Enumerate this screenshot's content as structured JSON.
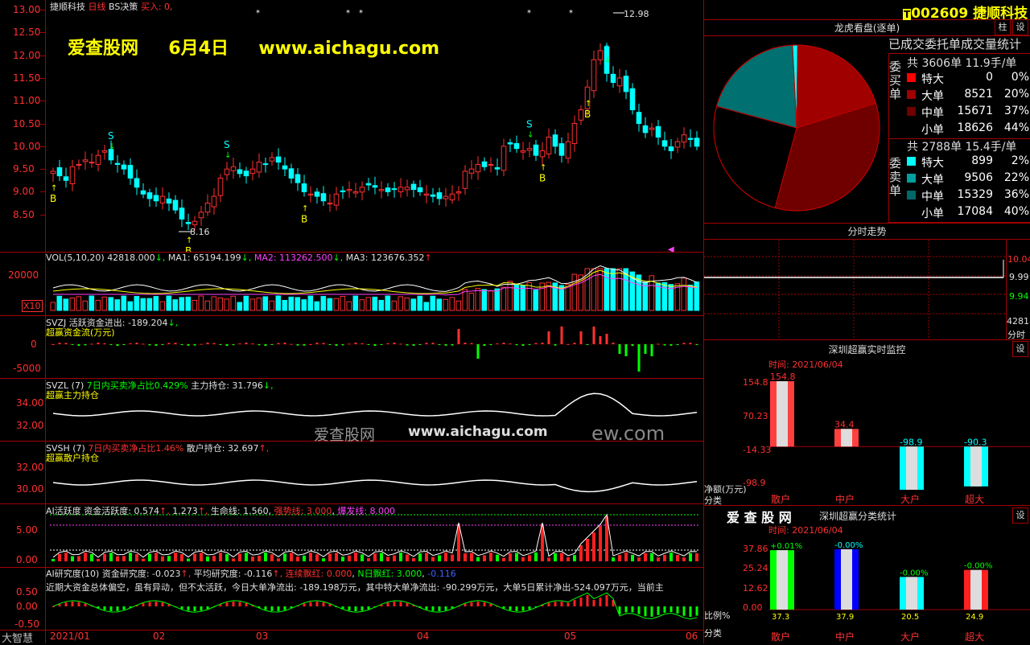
{
  "main_chart": {
    "stock_name": "捷顺科技",
    "period": "日线",
    "strategy": "BS决策",
    "buy_label": "买入: 0,",
    "watermark_site": "爱查股网",
    "watermark_date": "6月4日",
    "watermark_url": "www.aichagu.com",
    "high_label": "12.98",
    "low_label": "8.16",
    "y_axis": [
      "13.00",
      "12.50",
      "12.00",
      "11.50",
      "11.00",
      "10.50",
      "10.00",
      "9.50",
      "9.00",
      "8.50"
    ]
  },
  "vol_panel": {
    "title": "VOL(5,10,20)",
    "val": "42818.000",
    "ma1_label": "MA1: 65194.199",
    "ma2_label": "MA2: 113262.500",
    "ma3_label": "MA3: 123676.352",
    "y_axis": [
      "20000"
    ],
    "unit": "X10"
  },
  "svzj_panel": {
    "title": "SVZJ",
    "desc": "活跃资金进出: -189.204",
    "subtitle": "超赢资金流(万元)",
    "y_axis": [
      "0",
      "-5000"
    ]
  },
  "svzl_panel": {
    "title": "SVZL (7)",
    "ratio_label": "7日内买卖净占比0.429%",
    "hold_label": "主力持仓: 31.796",
    "subtitle": "超赢主力持仓",
    "y_axis": [
      "34.00",
      "32.00"
    ],
    "watermark": "爱查股网",
    "watermark_url": "www.aichagu.com",
    "watermark_tail": "ew.com"
  },
  "svsh_panel": {
    "title": "SVSH (7)",
    "ratio_label": "7日内买卖净占比1.46%",
    "hold_label": "散户持仓: 32.697",
    "subtitle": "超赢散户持仓",
    "y_axis": [
      "32.00",
      "30.00"
    ]
  },
  "ai_active_panel": {
    "title": "AI活跃度",
    "activity_label": "资金活跃度: 0.574",
    "v2": "1.273",
    "life_label": "生命线: 1.560",
    "strong_label": "强势线: 3.000",
    "burst_label": "爆发线: 8.000",
    "y_axis": [
      "5.00",
      "0.00"
    ]
  },
  "ai_research_panel": {
    "title": "AI研究度(10)",
    "research_label": "资金研究度: -0.023",
    "avg_label": "平均研究度: -0.116",
    "red_label": "连续飘红: 0.000",
    "n_label": "N日飘红: 3.000",
    "tail_val": "-0.116",
    "commentary": "近期大资金总体偏空，虽有异动，但不太活跃，今日大单净流出: -189.198万元，其中特大单净流出: -90.299万元，大单5日累计净出-524.097万元，当前主",
    "y_axis": [
      "0.50",
      "0.00",
      "-0.50"
    ]
  },
  "x_axis": {
    "label_left": "大智慧",
    "dates": [
      "2021/01",
      "02",
      "03",
      "04",
      "05",
      "06"
    ]
  },
  "right_header": {
    "code": "002609",
    "name": "捷顺科技"
  },
  "dragon_tiger": {
    "title": "龙虎看盘(逐单)",
    "btn_pin": "柱",
    "btn_settings": "设",
    "subtitle": "已成交委托单成交量统计",
    "buy_side_label": "委买单",
    "buy_total": "共 3606单 11.9手/单",
    "buy_rows": [
      {
        "name": "特大",
        "count": "0",
        "pct": "0%",
        "color": "#ff0000"
      },
      {
        "name": "大单",
        "count": "8521",
        "pct": "20%",
        "color": "#a00000"
      },
      {
        "name": "中单",
        "count": "15671",
        "pct": "37%",
        "color": "#700000"
      },
      {
        "name": "小单",
        "count": "18626",
        "pct": "44%",
        "color": "#000000"
      }
    ],
    "sell_side_label": "委卖单",
    "sell_total": "共 2788单 15.4手/单",
    "sell_rows": [
      {
        "name": "特大",
        "count": "899",
        "pct": "2%",
        "color": "#00ffff"
      },
      {
        "name": "大单",
        "count": "9506",
        "pct": "22%",
        "color": "#00a0a0"
      },
      {
        "name": "中单",
        "count": "15329",
        "pct": "36%",
        "color": "#006868"
      },
      {
        "name": "小单",
        "count": "17084",
        "pct": "40%",
        "color": "#000000"
      }
    ]
  },
  "intraday": {
    "title": "分时走势",
    "y_axis": [
      "10.04",
      "9.99",
      "9.94"
    ],
    "vol_label": "42818",
    "time_label": "分时"
  },
  "realtime_monitor": {
    "title": "深圳超赢实时监控",
    "btn_settings": "设",
    "time_label": "时间: 2021/06/04",
    "y_axis": [
      "154.8",
      "70.23",
      "-14.33",
      "-98.9"
    ],
    "unit_label": "净额(万元)",
    "category_label": "分类",
    "bars": [
      {
        "name": "散户",
        "value": 154.8,
        "label": "154.8",
        "color": "#ff4040"
      },
      {
        "name": "中户",
        "value": 34.4,
        "label": "34.4",
        "color": "#ff4040"
      },
      {
        "name": "大户",
        "value": -98.9,
        "label": "-98.9",
        "color": "#00ffff"
      },
      {
        "name": "超大",
        "value": -90.3,
        "label": "-90.3",
        "color": "#00ffff"
      }
    ]
  },
  "class_stats": {
    "site": "爱 查 股 网",
    "title": "深圳超赢分类统计",
    "btn_settings": "设",
    "time_label": "时间: 2021/06/04",
    "y_axis": [
      "37.86",
      "25.24",
      "12.62",
      "0.00"
    ],
    "ratio_label": "比例%",
    "category_label": "分类",
    "bars": [
      {
        "name": "散户",
        "value": 37.3,
        "label": "37.3",
        "change": "+0.01%",
        "color": "#00ff00"
      },
      {
        "name": "中户",
        "value": 37.9,
        "label": "37.9",
        "change": "-0.00%",
        "color": "#0000ff"
      },
      {
        "name": "大户",
        "value": 20.5,
        "label": "20.5",
        "change": "-0.00%",
        "color": "#00ffff"
      },
      {
        "name": "超大",
        "value": 24.9,
        "label": "24.9",
        "change": "-0.00%",
        "color": "#ff2020"
      }
    ]
  },
  "chart_data": {
    "type": "candlestick",
    "title": "捷顺科技 日线",
    "x_range": [
      "2021/01",
      "2021/06/04"
    ],
    "ylim": [
      8.16,
      12.98
    ],
    "close": [
      9.45,
      9.35,
      9.25,
      9.55,
      9.6,
      9.7,
      9.65,
      9.8,
      9.9,
      9.7,
      9.6,
      9.5,
      9.3,
      9.1,
      8.95,
      8.85,
      8.8,
      8.9,
      8.75,
      8.6,
      8.4,
      8.3,
      8.35,
      8.55,
      8.75,
      8.9,
      9.3,
      9.5,
      9.55,
      9.4,
      9.35,
      9.5,
      9.65,
      9.6,
      9.75,
      9.65,
      9.5,
      9.3,
      9.2,
      9.0,
      8.95,
      8.9,
      8.8,
      8.75,
      8.95,
      9.0,
      9.05,
      9.0,
      9.1,
      9.15,
      9.1,
      9.05,
      9.0,
      9.05,
      9.1,
      9.1,
      9.05,
      9.0,
      8.95,
      8.9,
      8.85,
      8.9,
      8.95,
      9.0,
      9.45,
      9.5,
      9.6,
      9.55,
      9.6,
      9.5,
      10.0,
      10.05,
      9.95,
      9.9,
      9.95,
      9.8,
      9.9,
      10.2,
      10.0,
      9.8,
      10.1,
      10.5,
      10.8,
      11.3,
      11.9,
      12.1,
      11.6,
      11.4,
      11.5,
      11.2,
      10.8,
      10.5,
      10.3,
      10.4,
      10.2,
      10.0,
      9.9,
      10.1,
      10.25,
      10.15,
      10.0
    ]
  }
}
